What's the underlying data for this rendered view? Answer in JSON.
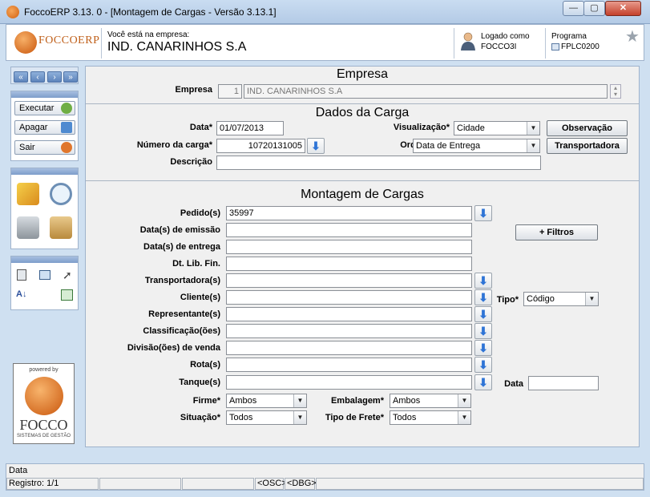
{
  "window": {
    "title": "FoccoERP  3.13.  0 - [Montagem de Cargas - Versão 3.13.1]",
    "min": "—",
    "max": "▢",
    "close": "✕"
  },
  "header": {
    "logo": "FOCCOERP",
    "company_caption": "Você está na empresa:",
    "company_name": "IND. CANARINHOS S.A",
    "logged_caption": "Logado como",
    "logged_user": "FOCCO3I",
    "program_caption": "Programa",
    "program_code": "FPLC0200"
  },
  "sidebar": {
    "nav": [
      "«",
      "‹",
      "›",
      "»"
    ],
    "actions": [
      {
        "label": "Executar",
        "color": "#6fae44"
      },
      {
        "label": "Apagar",
        "color": "#4f8ad0"
      },
      {
        "label": "Sair",
        "color": "#e0762c"
      }
    ],
    "powered_by": "powered by",
    "focco": "FOCCO",
    "focco_sub": "SISTEMAS DE GESTÃO"
  },
  "empresa": {
    "section": "Empresa",
    "label": "Empresa",
    "code": "1",
    "name": "IND. CANARINHOS S.A"
  },
  "carga": {
    "section": "Dados da Carga",
    "data_label": "Data*",
    "data_value": "01/07/2013",
    "numero_label": "Número da carga*",
    "numero_value": "10720131005",
    "descricao_label": "Descrição",
    "descricao_value": "",
    "visualizacao_label": "Visualização*",
    "visualizacao_value": "Cidade",
    "ordenacao_label": "Ordenação*",
    "ordenacao_value": "Data de Entrega",
    "observacao_btn": "Observação",
    "transportadora_btn": "Transportadora"
  },
  "montagem": {
    "section": "Montagem de Cargas",
    "fields": [
      {
        "label": "Pedido(s)",
        "value": "35997",
        "arrow": true
      },
      {
        "label": "Data(s) de emissão",
        "value": "",
        "arrow": false
      },
      {
        "label": "Data(s) de entrega",
        "value": "",
        "arrow": false
      },
      {
        "label": "Dt. Lib. Fin.",
        "value": "",
        "arrow": false
      },
      {
        "label": "Transportadora(s)",
        "value": "",
        "arrow": true
      },
      {
        "label": "Cliente(s)",
        "value": "",
        "arrow": true
      },
      {
        "label": "Representante(s)",
        "value": "",
        "arrow": true
      },
      {
        "label": "Classificação(ões)",
        "value": "",
        "arrow": true
      },
      {
        "label": "Divisão(ões) de venda",
        "value": "",
        "arrow": true
      },
      {
        "label": "Rota(s)",
        "value": "",
        "arrow": true
      },
      {
        "label": "Tanque(s)",
        "value": "",
        "arrow": true
      }
    ],
    "filtros_btn": "+ Filtros",
    "tipo_label": "Tipo*",
    "tipo_value": "Código",
    "data_label": "Data",
    "data_value": "",
    "firme_label": "Firme*",
    "firme_value": "Ambos",
    "embalagem_label": "Embalagem*",
    "embalagem_value": "Ambos",
    "situacao_label": "Situação*",
    "situacao_value": "Todos",
    "frete_label": "Tipo de Frete*",
    "frete_value": "Todos"
  },
  "status": {
    "message": "Data",
    "registro": "Registro: 1/1",
    "osc": "<OSC>",
    "dbg": "<DBG>"
  }
}
